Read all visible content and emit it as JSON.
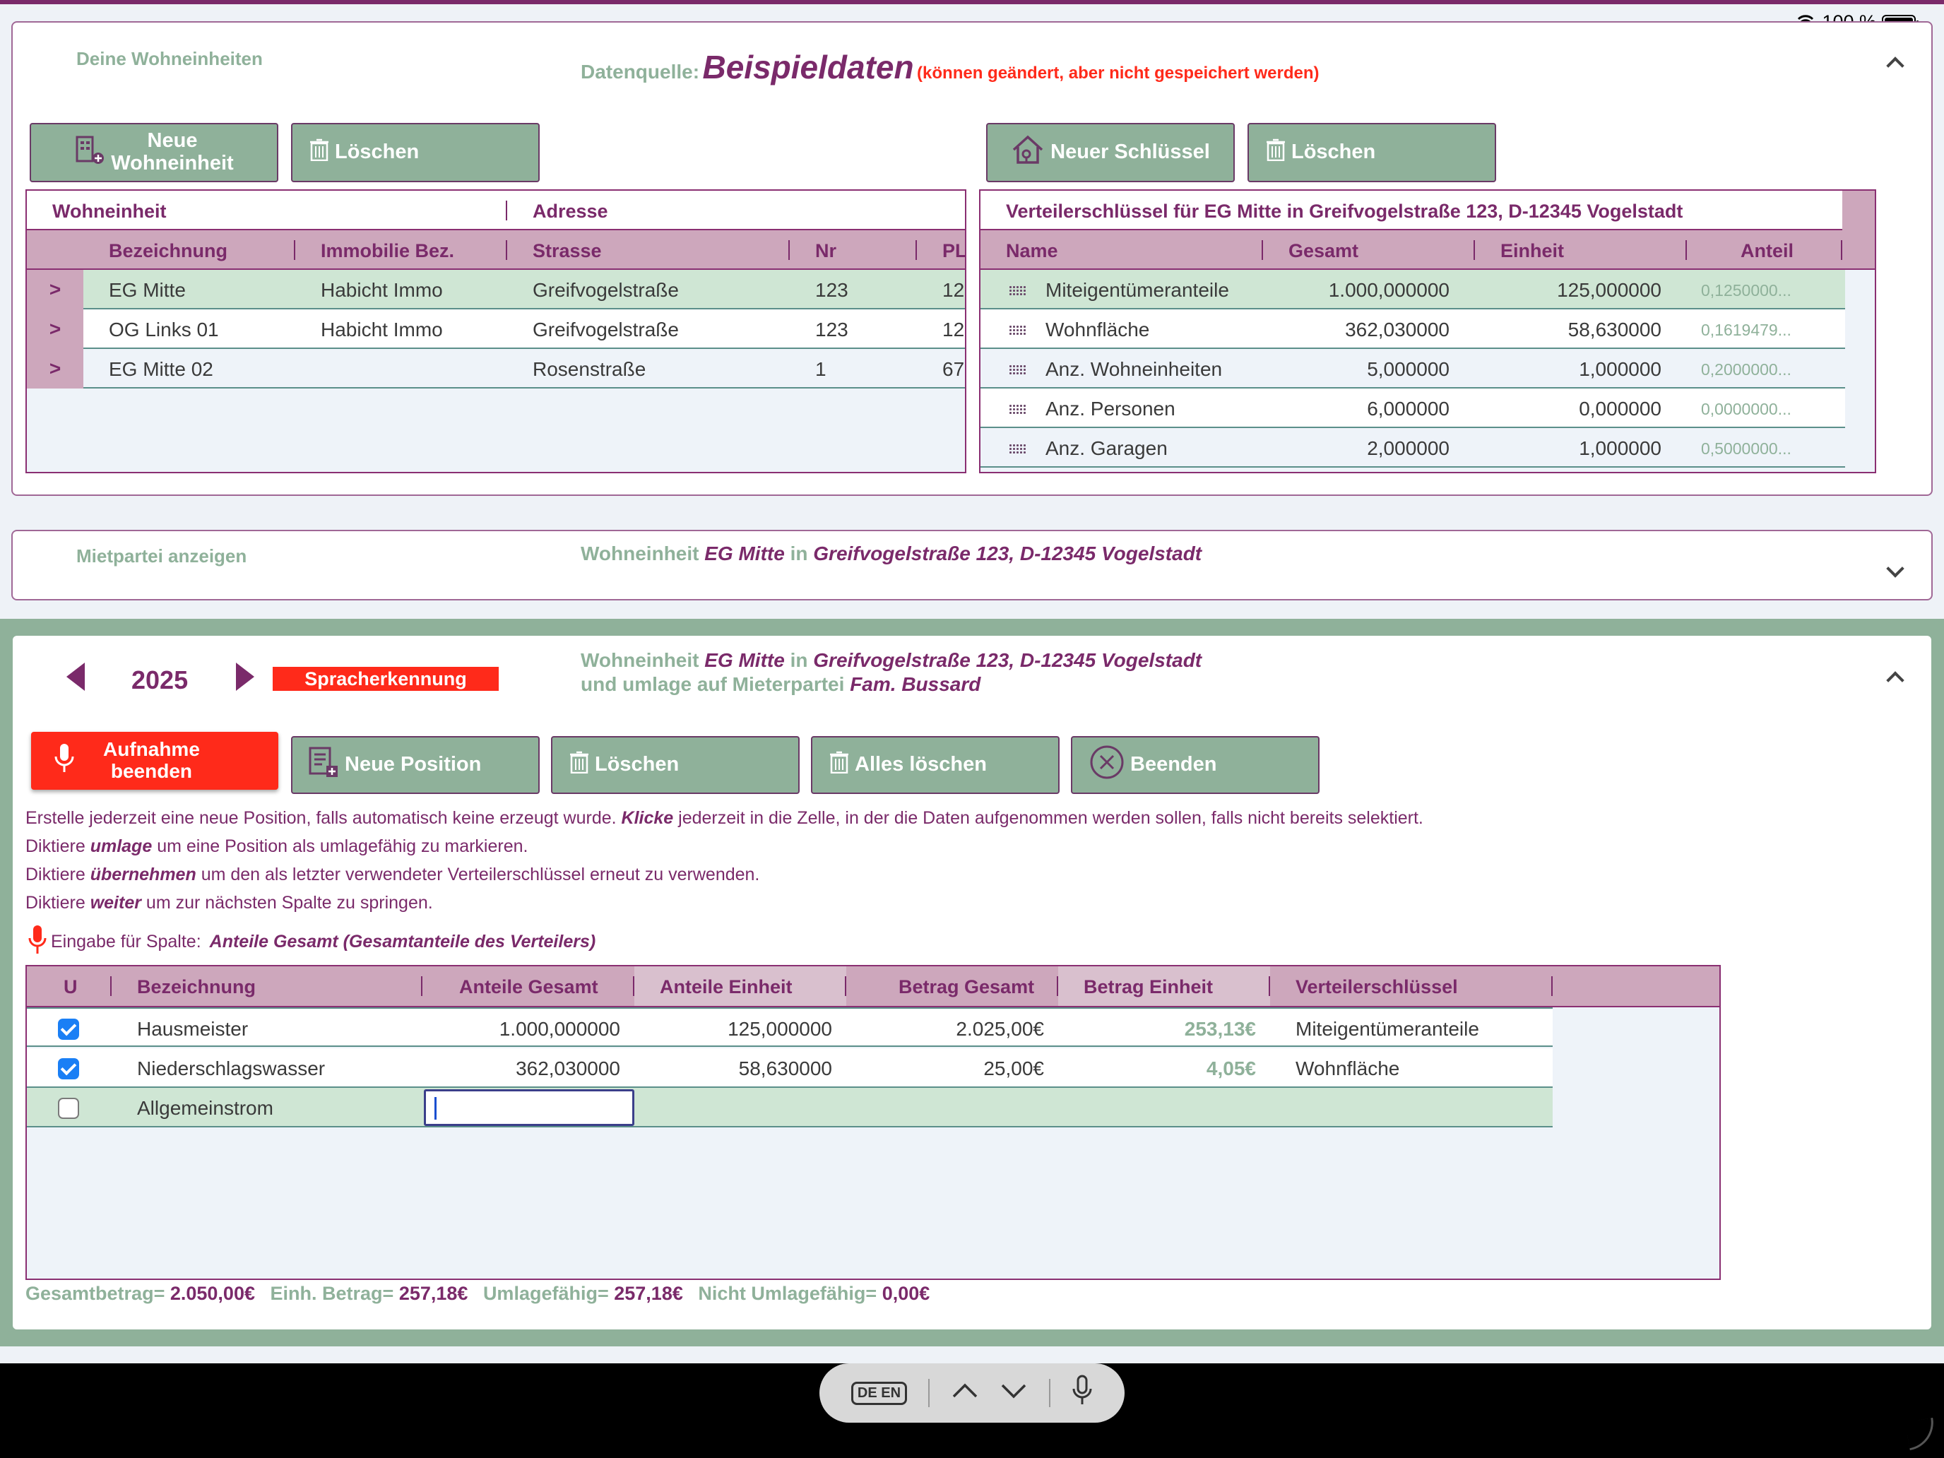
{
  "status_bar": {
    "battery": "100 %"
  },
  "units_panel": {
    "title": "Deine Wohneinheiten",
    "datasource_label": "Datenquelle:",
    "datasource_value": "Beispieldaten",
    "datasource_note": "(können geändert, aber nicht gespeichert werden)",
    "btn_new_unit_l1": "Neue",
    "btn_new_unit_l2": "Wohneinheit",
    "btn_delete": "Löschen",
    "btn_new_key": "Neuer Schlüssel",
    "btn_delete_key": "Löschen",
    "units_table": {
      "group_unit": "Wohneinheit",
      "group_address": "Adresse",
      "headers": [
        "Bezeichnung",
        "Immobilie Bez.",
        "Strasse",
        "Nr",
        "PL"
      ],
      "rows": [
        {
          "arrow": ">",
          "name": "EG Mitte",
          "property": "Habicht Immo",
          "street": "Greifvogelstraße",
          "nr": "123",
          "plz": "12"
        },
        {
          "arrow": ">",
          "name": "OG Links 01",
          "property": "Habicht Immo",
          "street": "Greifvogelstraße",
          "nr": "123",
          "plz": "12"
        },
        {
          "arrow": ">",
          "name": "EG Mitte 02",
          "property": "",
          "street": "Rosenstraße",
          "nr": "1",
          "plz": "67"
        }
      ]
    },
    "keys_table": {
      "title": "Verteilerschlüssel für EG Mitte in Greifvogelstraße 123, D-12345 Vogelstadt",
      "headers": [
        "Name",
        "Gesamt",
        "Einheit",
        "Anteil"
      ],
      "rows": [
        {
          "name": "Miteigentümeranteile",
          "total": "1.000,000000",
          "unit": "125,000000",
          "share": "0,1250000..."
        },
        {
          "name": "Wohnfläche",
          "total": "362,030000",
          "unit": "58,630000",
          "share": "0,1619479..."
        },
        {
          "name": "Anz. Wohneinheiten",
          "total": "5,000000",
          "unit": "1,000000",
          "share": "0,2000000..."
        },
        {
          "name": "Anz. Personen",
          "total": "6,000000",
          "unit": "0,000000",
          "share": "0,0000000..."
        },
        {
          "name": "Anz. Garagen",
          "total": "2,000000",
          "unit": "1,000000",
          "share": "0,5000000..."
        }
      ]
    }
  },
  "tenant_panel": {
    "title": "Mietpartei anzeigen",
    "info_prefix": "Wohneinheit",
    "info_unit": "EG Mitte",
    "info_in": "in",
    "info_address": "Greifvogelstraße 123, D-12345 Vogelstadt"
  },
  "costs_panel": {
    "year": "2025",
    "speech_badge": "Spracherkennung",
    "info_prefix": "Wohneinheit",
    "info_unit": "EG Mitte",
    "info_in": "in",
    "info_address": "Greifvogelstraße 123, D-12345 Vogelstadt",
    "info_line2_prefix": "und umlage auf Mieterpartei",
    "info_tenant": "Fam. Bussard",
    "btn_stop_rec_l1": "Aufnahme",
    "btn_stop_rec_l2": "beenden",
    "btn_new_position": "Neue Position",
    "btn_delete": "Löschen",
    "btn_delete_all": "Alles löschen",
    "btn_quit": "Beenden",
    "help1_a": "Erstelle jederzeit eine neue Position, falls automatisch keine erzeugt wurde.",
    "help1_b": "Klicke",
    "help1_c": "jederzeit in die Zelle, in der die Daten aufgenommen werden sollen, falls nicht bereits selektiert.",
    "help2_a": "Diktiere",
    "help2_b": "umlage",
    "help2_c": "um eine Position als umlagefähig zu markieren.",
    "help3_a": "Diktiere",
    "help3_b": "übernehmen",
    "help3_c": "um den als letzter verwendeter Verteilerschlüssel erneut zu verwenden.",
    "help4_a": "Diktiere",
    "help4_b": "weiter",
    "help4_c": "um zur nächsten Spalte zu springen.",
    "input_label": "Eingabe für Spalte:",
    "input_column": "Anteile Gesamt (Gesamtanteile des Verteilers)",
    "table": {
      "headers": [
        "U",
        "Bezeichnung",
        "Anteile Gesamt",
        "Anteile Einheit",
        "Betrag Gesamt",
        "Betrag Einheit",
        "Verteilerschlüssel"
      ],
      "rows": [
        {
          "checked": true,
          "name": "Hausmeister",
          "shares_total": "1.000,000000",
          "shares_unit": "125,000000",
          "amount_total": "2.025,00€",
          "amount_unit": "253,13€",
          "key": "Miteigentümeranteile"
        },
        {
          "checked": true,
          "name": "Niederschlagswasser",
          "shares_total": "362,030000",
          "shares_unit": "58,630000",
          "amount_total": "25,00€",
          "amount_unit": "4,05€",
          "key": "Wohnfläche"
        },
        {
          "checked": false,
          "name": "Allgemeinstrom",
          "shares_total": "",
          "shares_unit": "",
          "amount_total": "",
          "amount_unit": "",
          "key": ""
        }
      ]
    },
    "totals": {
      "total_label": "Gesamtbetrag=",
      "total_value": "2.050,00€",
      "unit_label": "Einh. Betrag=",
      "unit_value": "257,18€",
      "alloc_label": "Umlagefähig=",
      "alloc_value": "257,18€",
      "nonalloc_label": "Nicht Umlagefähig=",
      "nonalloc_value": "0,00€"
    }
  },
  "keyboard_bar": {
    "lang_icon_text": "DE EN"
  },
  "colors": {
    "purple": "#7a2a6a",
    "green": "#8fb19a",
    "red": "#ff2a1a",
    "header_pink": "#cda7bc"
  }
}
